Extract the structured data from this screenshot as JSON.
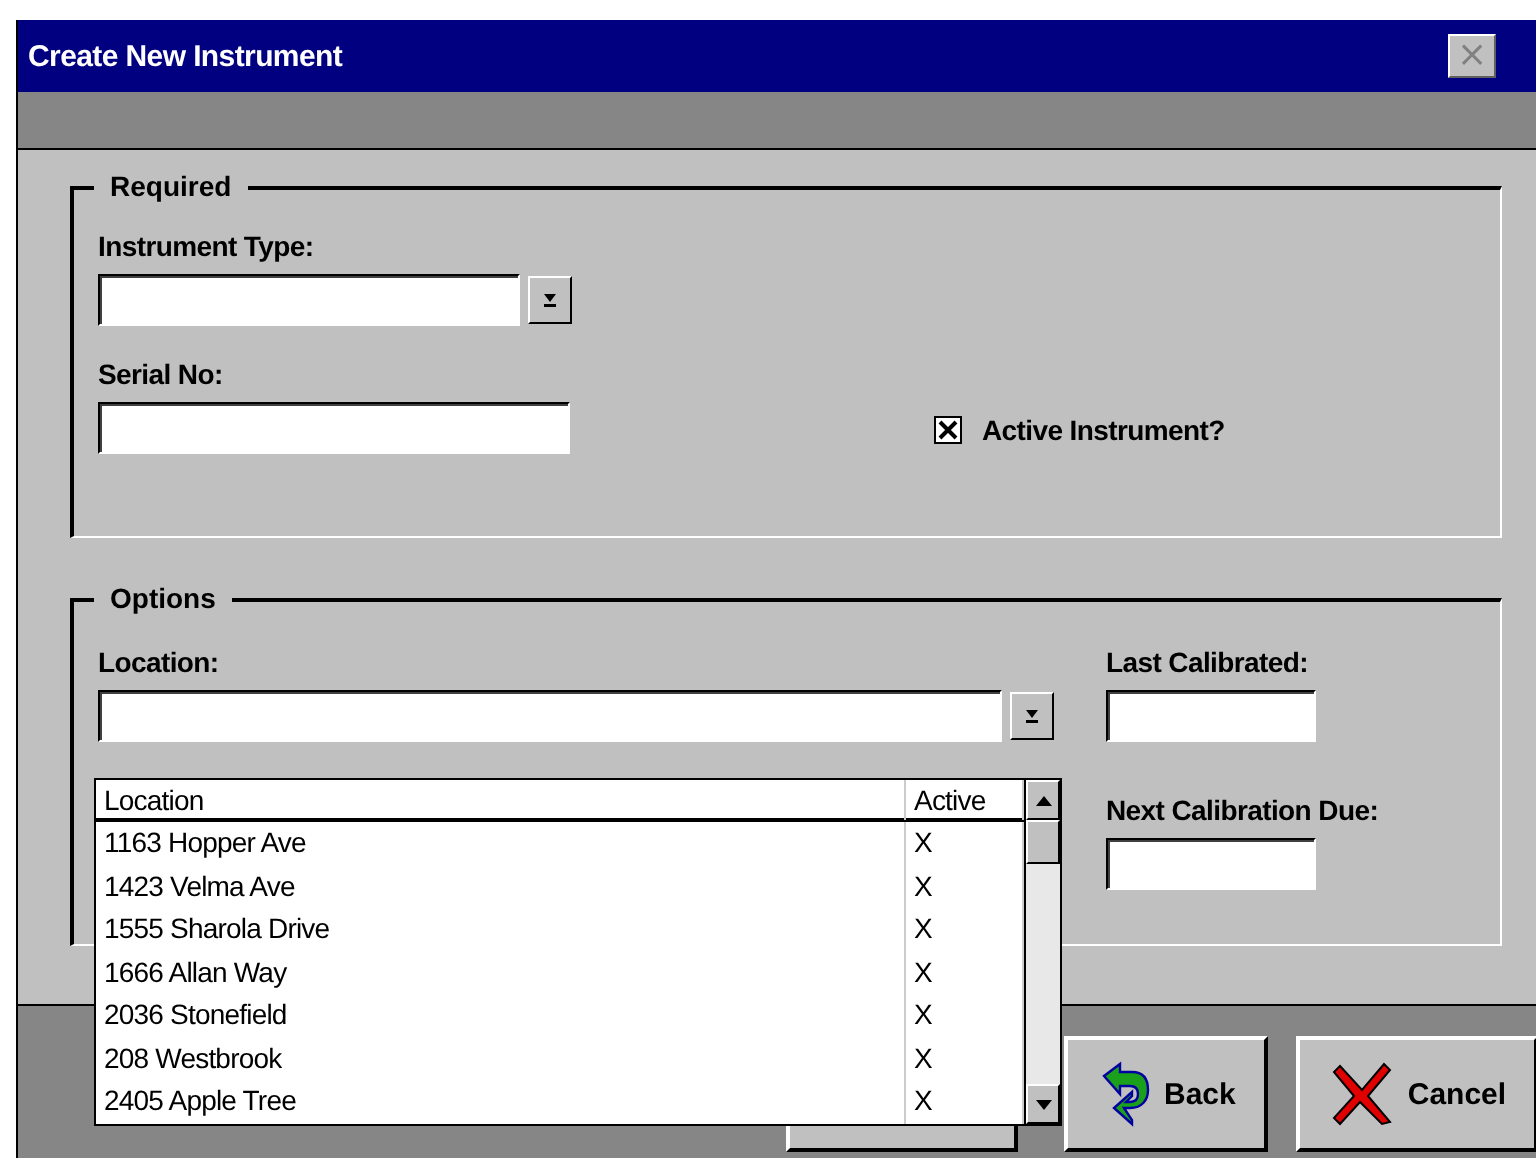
{
  "window": {
    "title": "Create New Instrument",
    "close": "×"
  },
  "required": {
    "legend": "Required",
    "instrument_type": {
      "label": "Instrument Type:"
    },
    "serial_no": {
      "label": "Serial No:"
    },
    "active": {
      "label": "Active Instrument?",
      "checked": true
    }
  },
  "options": {
    "legend": "Options",
    "location": {
      "label": "Location:",
      "dropdown": {
        "expanded": true,
        "columns": [
          "Location",
          "Active"
        ],
        "rows": [
          {
            "location": "1163 Hopper Ave",
            "active": "X"
          },
          {
            "location": "1423 Velma Ave",
            "active": "X"
          },
          {
            "location": "1555 Sharola Drive",
            "active": "X"
          },
          {
            "location": "1666 Allan Way",
            "active": "X"
          },
          {
            "location": "2036 Stonefield",
            "active": "X"
          },
          {
            "location": "208 Westbrook",
            "active": "X"
          },
          {
            "location": "2405 Apple Tree",
            "active": "X"
          }
        ]
      }
    },
    "last_calibrated": {
      "label": "Last Calibrated:"
    },
    "next_calibration_due": {
      "label": "Next Calibration Due:"
    }
  },
  "buttons": [
    {
      "kind": "back",
      "label": "Back"
    },
    {
      "kind": "cancel",
      "label": "Cancel"
    }
  ]
}
